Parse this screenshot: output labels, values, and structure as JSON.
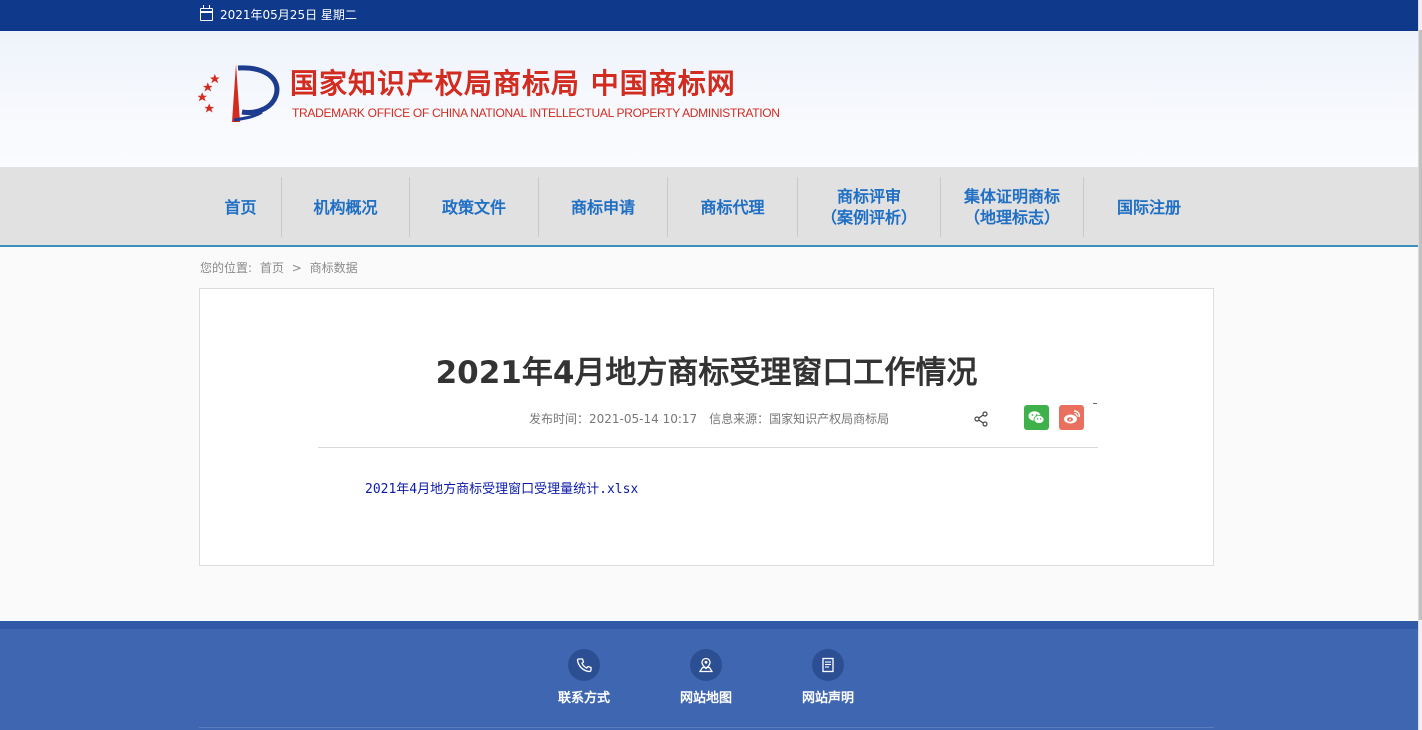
{
  "topbar": {
    "date": "2021年05月25日 星期二"
  },
  "header": {
    "title_cn": "国家知识产权局商标局 中国商标网",
    "title_en": "TRADEMARK OFFICE OF CHINA NATIONAL INTELLECTUAL PROPERTY ADMINISTRATION"
  },
  "nav": {
    "items": [
      {
        "label": "首页"
      },
      {
        "label": "机构概况"
      },
      {
        "label": "政策文件"
      },
      {
        "label": "商标申请"
      },
      {
        "label": "商标代理"
      },
      {
        "label": "商标评审",
        "label2": "（案例评析）"
      },
      {
        "label": "集体证明商标",
        "label2": "（地理标志）"
      },
      {
        "label": "国际注册"
      }
    ]
  },
  "breadcrumb": {
    "prefix": "您的位置:",
    "home": "首页",
    "sep": ">",
    "current": "商标数据"
  },
  "article": {
    "title": "2021年4月地方商标受理窗口工作情况",
    "publish_label": "发布时间：",
    "publish_time": "2021-05-14 10:17",
    "source_label": "信息来源：",
    "source": "国家知识产权局商标局",
    "attachment": "2021年4月地方商标受理窗口受理量统计.xlsx"
  },
  "share": {
    "icons": [
      "share-icon",
      "wechat-icon",
      "weibo-icon"
    ]
  },
  "footer": {
    "links": [
      {
        "label": "联系方式",
        "icon": "phone-icon"
      },
      {
        "label": "网站地图",
        "icon": "map-icon"
      },
      {
        "label": "网站声明",
        "icon": "document-icon"
      }
    ]
  },
  "colors": {
    "topbar": "#0f3a8c",
    "nav_text": "#1f6fc4",
    "brand_red": "#d22b20",
    "footer": "#3f67b1",
    "link": "#0b1aa8"
  }
}
